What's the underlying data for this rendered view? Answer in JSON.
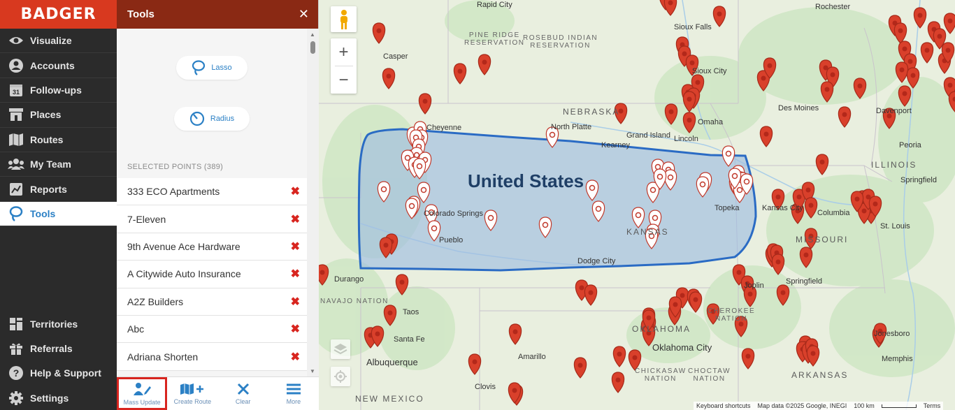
{
  "app": {
    "logo": "BADGER"
  },
  "nav": {
    "items": [
      {
        "label": "Visualize",
        "icon": "eye-icon"
      },
      {
        "label": "Accounts",
        "icon": "person-icon"
      },
      {
        "label": "Follow-ups",
        "icon": "calendar-icon",
        "calendar_day": "31"
      },
      {
        "label": "Places",
        "icon": "storefront-icon"
      },
      {
        "label": "Routes",
        "icon": "map-icon"
      },
      {
        "label": "My Team",
        "icon": "team-icon"
      },
      {
        "label": "Reports",
        "icon": "chart-icon"
      },
      {
        "label": "Tools",
        "icon": "lasso-icon",
        "active": true
      }
    ],
    "bottom_items": [
      {
        "label": "Territories",
        "icon": "territories-icon"
      },
      {
        "label": "Referrals",
        "icon": "gift-icon"
      },
      {
        "label": "Help & Support",
        "icon": "help-icon"
      },
      {
        "label": "Settings",
        "icon": "gear-icon"
      }
    ]
  },
  "tools_panel": {
    "title": "Tools",
    "close": "✕",
    "lasso_label": "Lasso",
    "radius_label": "Radius",
    "selected_header": "SELECTED POINTS (389)",
    "points": [
      "333 ECO Apartments",
      "7-Eleven",
      "9th Avenue Ace Hardware",
      "A Citywide Auto Insurance",
      "A2Z Builders",
      "Abc",
      "Adriana Shorten"
    ],
    "remove_glyph": "✖",
    "toolbar": [
      {
        "label": "Mass Update",
        "icon": "mass-update-icon",
        "active": true
      },
      {
        "label": "Create Route",
        "icon": "create-route-icon"
      },
      {
        "label": "Clear",
        "icon": "clear-icon"
      },
      {
        "label": "More",
        "icon": "menu-icon"
      }
    ]
  },
  "map": {
    "country_label": "United States",
    "state_labels": [
      "NEBRASKA",
      "ILLINOIS",
      "MISSOURI",
      "KANSAS",
      "OKLAHOMA",
      "NEW MEXICO",
      "ARKANSAS"
    ],
    "reservation_labels": [
      "PINE RIDGE\nRESERVATION",
      "ROSEBUD INDIAN\nRESERVATION",
      "NAVAJO NATION",
      "CHEROKEE\nNATION",
      "CHOCTAW\nNATION",
      "CHICKASAW\nNATION"
    ],
    "city_labels": [
      "Rapid City",
      "Sioux Falls",
      "Rochester",
      "Casper",
      "Cheyenne",
      "North Platte",
      "Grand Island",
      "Kearney",
      "Omaha",
      "Lincoln",
      "Des Moines",
      "Davenport",
      "Peoria",
      "Springfield",
      "Colorado Springs",
      "Pueblo",
      "Dodge City",
      "Topeka",
      "Kansas City",
      "Columbia",
      "St. Louis",
      "Joplin",
      "Springfield",
      "Durango",
      "Taos",
      "Santa Fe",
      "Albuquerque",
      "Amarillo",
      "Oklahoma City",
      "Clovis",
      "Jonesboro",
      "Memphis",
      "Sioux City"
    ],
    "attribution": {
      "shortcuts": "Keyboard shortcuts",
      "data": "Map data ©2025 Google, INEGI",
      "scale": "100 km",
      "terms": "Terms"
    },
    "zoom_in": "+",
    "zoom_out": "−"
  },
  "colors": {
    "brand_red": "#d8391f",
    "panel_header": "#8a2914",
    "nav_bg": "#2b2b2b",
    "accent_blue": "#2b80c5",
    "pin_red": "#d9402b",
    "selection_fill": "#a9c3e0",
    "selection_stroke": "#2a6bc4"
  }
}
